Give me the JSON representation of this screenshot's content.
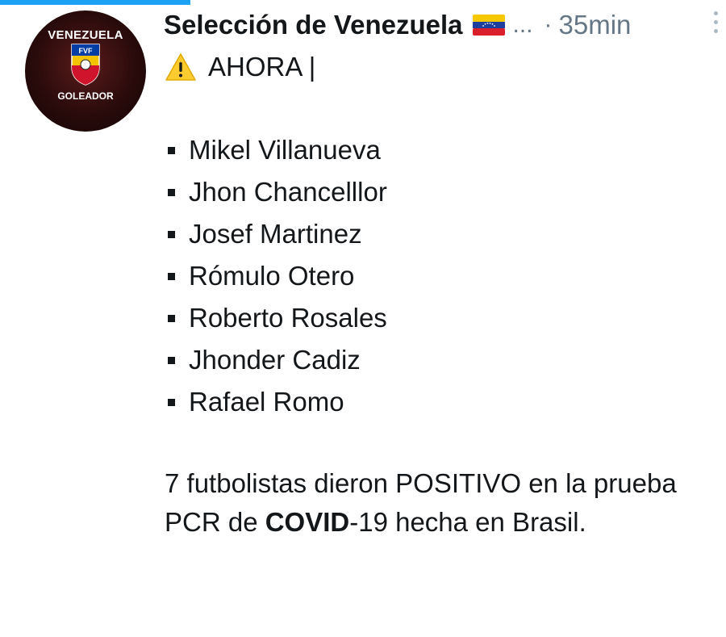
{
  "tweet": {
    "display_name": "Selección de Venezuela",
    "flag_icon": "venezuela-flag-icon",
    "ellipsis": "...",
    "separator": "·",
    "time_ago": "35min",
    "avatar": {
      "top_text": "VENEZUELA",
      "bottom_text": "GOLEADOR",
      "crest_text": "FVF"
    },
    "alert": {
      "icon": "warning-icon",
      "text": "AHORA |"
    },
    "players": [
      "Mikel Villanueva",
      "Jhon Chancelllor",
      "Josef Martinez",
      "Rómulo Otero",
      "Roberto Rosales",
      "Jhonder Cadiz",
      "Rafael Romo"
    ],
    "summary": {
      "part1": "7 futbolistas dieron POSITIVO en la prueba PCR de ",
      "bold": "COVID",
      "part2": "-19 hecha en Brasil."
    }
  },
  "colors": {
    "accent": "#1da1f2",
    "text": "#14171a",
    "muted": "#657786"
  }
}
